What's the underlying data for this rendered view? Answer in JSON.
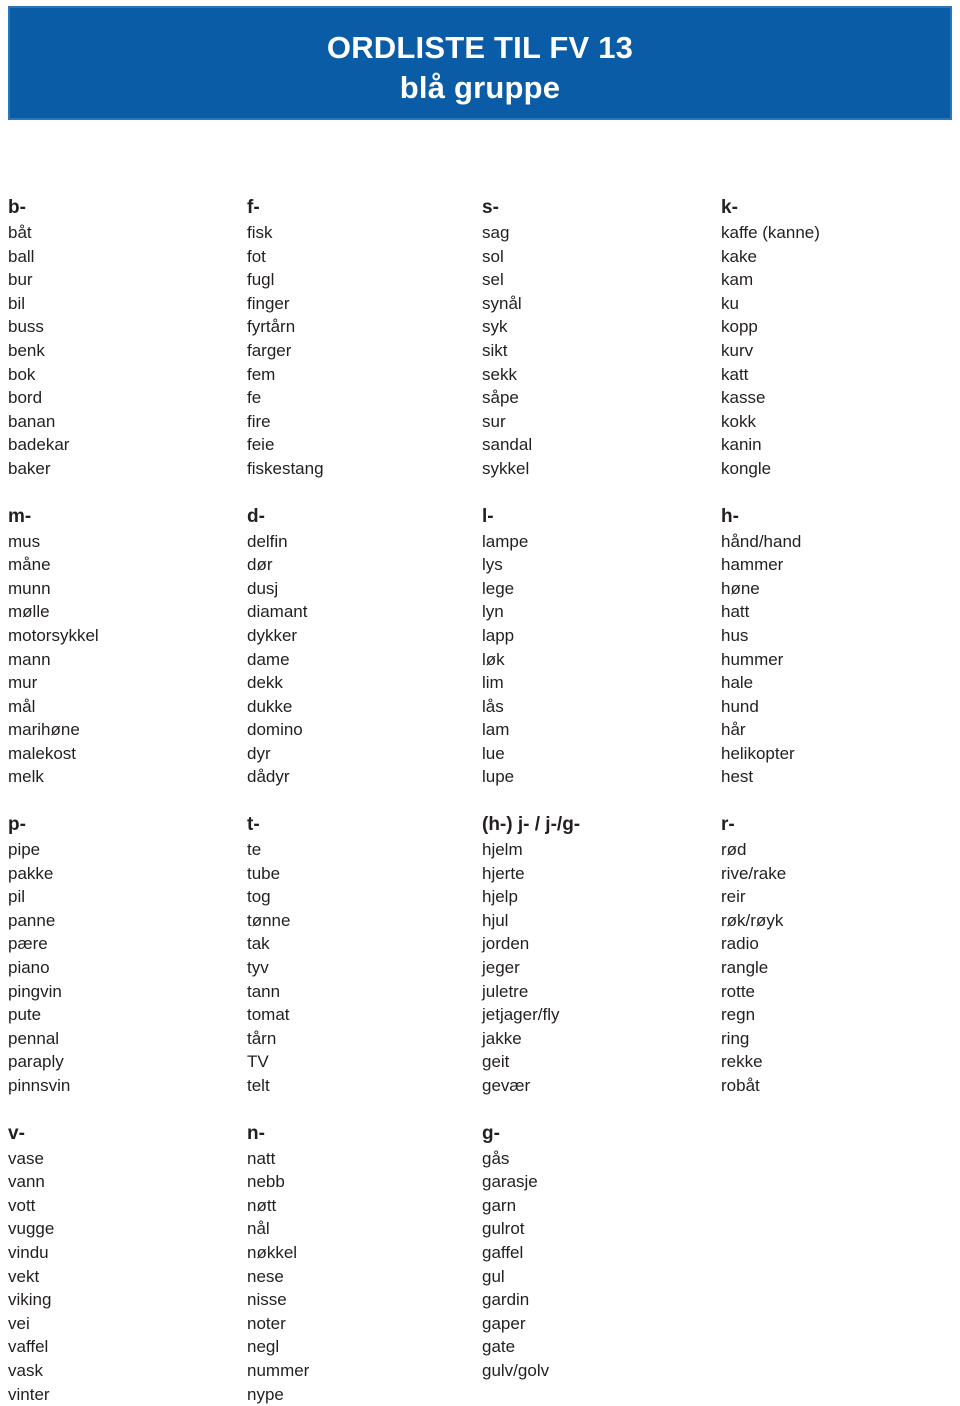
{
  "header": {
    "title_line1": "ORDLISTE TIL FV 13",
    "title_line2": "blå gruppe",
    "background_color": "#0b5ca6",
    "text_color": "#ffffff"
  },
  "groups": [
    [
      {
        "header": "b-",
        "words": [
          "båt",
          "ball",
          "bur",
          "bil",
          "buss",
          "benk",
          "bok",
          "bord",
          "banan",
          "badekar",
          "baker"
        ]
      },
      {
        "header": "f-",
        "words": [
          "fisk",
          "fot",
          "fugl",
          "finger",
          "fyrtårn",
          "farger",
          "fem",
          "fe",
          "fire",
          "feie",
          "fiskestang"
        ]
      },
      {
        "header": "s-",
        "words": [
          "sag",
          "sol",
          "sel",
          "synål",
          "syk",
          "sikt",
          "sekk",
          "såpe",
          "sur",
          "sandal",
          "sykkel"
        ]
      },
      {
        "header": "k-",
        "words": [
          "kaffe (kanne)",
          "kake",
          "kam",
          "ku",
          "kopp",
          "kurv",
          "katt",
          "kasse",
          "kokk",
          "kanin",
          "kongle"
        ]
      }
    ],
    [
      {
        "header": "m-",
        "words": [
          "mus",
          "måne",
          "munn",
          "mølle",
          "motorsykkel",
          "mann",
          "mur",
          "mål",
          "marihøne",
          "malekost",
          "melk"
        ]
      },
      {
        "header": "d-",
        "words": [
          "delfin",
          "dør",
          "dusj",
          "diamant",
          "dykker",
          "dame",
          "dekk",
          "dukke",
          "domino",
          "dyr",
          "dådyr"
        ]
      },
      {
        "header": "l-",
        "words": [
          "lampe",
          "lys",
          "lege",
          "lyn",
          "lapp",
          "løk",
          "lim",
          "lås",
          "lam",
          "lue",
          "lupe"
        ]
      },
      {
        "header": "h-",
        "words": [
          "hånd/hand",
          "hammer",
          "høne",
          "hatt",
          "hus",
          "hummer",
          "hale",
          "hund",
          "hår",
          "helikopter",
          "hest"
        ]
      }
    ],
    [
      {
        "header": "p-",
        "words": [
          "pipe",
          "pakke",
          "pil",
          "panne",
          "pære",
          "piano",
          "pingvin",
          "pute",
          "pennal",
          "paraply",
          "pinnsvin"
        ]
      },
      {
        "header": "t-",
        "words": [
          "te",
          "tube",
          "tog",
          "tønne",
          "tak",
          "tyv",
          "tann",
          "tomat",
          "tårn",
          "TV",
          "telt"
        ]
      },
      {
        "header": "(h-) j- / j-/g-",
        "words": [
          "hjelm",
          "hjerte",
          "hjelp",
          "hjul",
          "jorden",
          "jeger",
          "juletre",
          "jetjager/fly",
          "jakke",
          "geit",
          "gevær"
        ]
      },
      {
        "header": "r-",
        "words": [
          "rød",
          "rive/rake",
          "reir",
          "røk/røyk",
          "radio",
          "rangle",
          "rotte",
          "regn",
          "ring",
          "rekke",
          "robåt"
        ]
      }
    ],
    [
      {
        "header": "v-",
        "words": [
          "vase",
          "vann",
          "vott",
          "vugge",
          "vindu",
          "vekt",
          "viking",
          "vei",
          "vaffel",
          "vask",
          "vinter"
        ]
      },
      {
        "header": "n-",
        "words": [
          "natt",
          "nebb",
          "nøtt",
          "nål",
          "nøkkel",
          "nese",
          "nisse",
          "noter",
          "negl",
          "nummer",
          "nype"
        ]
      },
      {
        "header": "g-",
        "words": [
          "gås",
          "garasje",
          "garn",
          "gulrot",
          "gaffel",
          "gul",
          "gardin",
          "gaper",
          "gate",
          "gulv/golv"
        ]
      }
    ]
  ]
}
